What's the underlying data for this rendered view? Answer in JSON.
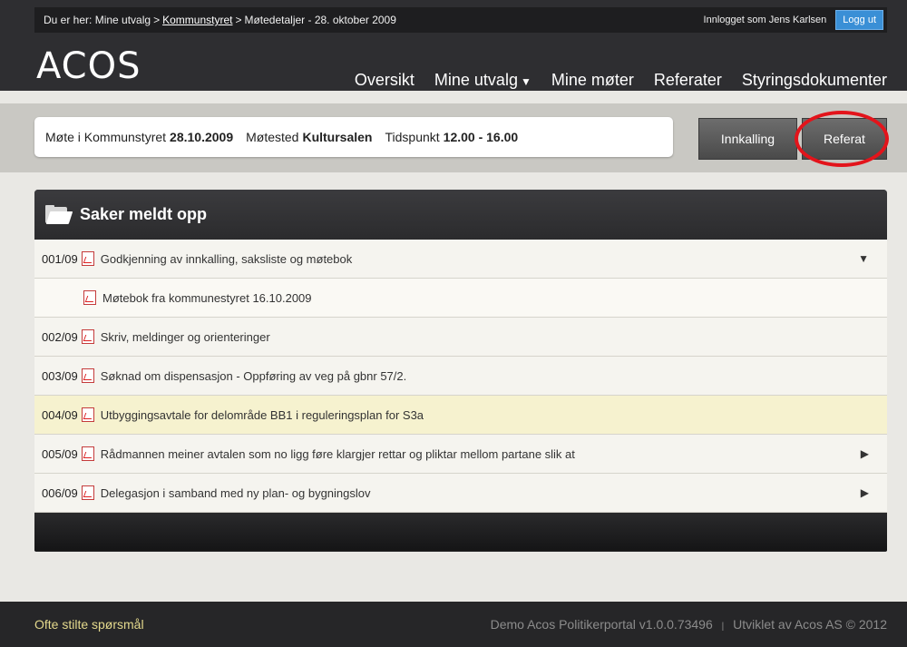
{
  "breadcrumb": {
    "prefix": "Du er her:",
    "item1": "Mine utvalg",
    "item2": "Kommunstyret",
    "item3": "Møtedetaljer - 28. oktober 2009",
    "separator": ">"
  },
  "login": {
    "text": "Innlogget som Jens Karlsen",
    "logout_label": "Logg ut"
  },
  "logo": "ACOS",
  "nav": {
    "items": [
      {
        "label": "Oversikt"
      },
      {
        "label": "Mine utvalg",
        "caret": "▼"
      },
      {
        "label": "Mine møter"
      },
      {
        "label": "Referater"
      },
      {
        "label": "Styringsdokumenter"
      }
    ]
  },
  "meeting": {
    "label_meeting": "Møte i Kommunstyret",
    "date": "28.10.2009",
    "label_place": "Møtested",
    "place": "Kultursalen",
    "label_time": "Tidspunkt",
    "time": "12.00 - 16.00"
  },
  "buttons": {
    "innkalling": "Innkalling",
    "referat": "Referat"
  },
  "panel": {
    "title": "Saker meldt opp"
  },
  "rows": [
    {
      "num": "001/09",
      "text": "Godkjenning av innkalling, saksliste og møtebok",
      "arrow": "▼"
    },
    {
      "num": "",
      "text": "Møtebok fra kommunestyret 16.10.2009",
      "arrow": ""
    },
    {
      "num": "002/09",
      "text": "Skriv, meldinger og orienteringer",
      "arrow": ""
    },
    {
      "num": "003/09",
      "text": "Søknad om dispensasjon - Oppføring av veg på gbnr 57/2.",
      "arrow": ""
    },
    {
      "num": "004/09",
      "text": "Utbyggingsavtale for delområde BB1 i reguleringsplan for S3a",
      "arrow": ""
    },
    {
      "num": "005/09",
      "text": "Rådmannen meiner avtalen som no ligg føre klargjer rettar og pliktar mellom partane slik at",
      "arrow": "▶"
    },
    {
      "num": "006/09",
      "text": "Delegasjon i samband med ny plan- og bygningslov",
      "arrow": "▶"
    }
  ],
  "footer": {
    "faq": "Ofte stilte spørsmål",
    "version": "Demo Acos Politikerportal v1.0.0.73496",
    "pipe": "|",
    "credit": "Utviklet av Acos AS © 2012"
  },
  "colors": {
    "accent_highlight": "#e3141b",
    "logout_blue": "#3a8fd6",
    "row_highlight": "#f6f2cf"
  }
}
